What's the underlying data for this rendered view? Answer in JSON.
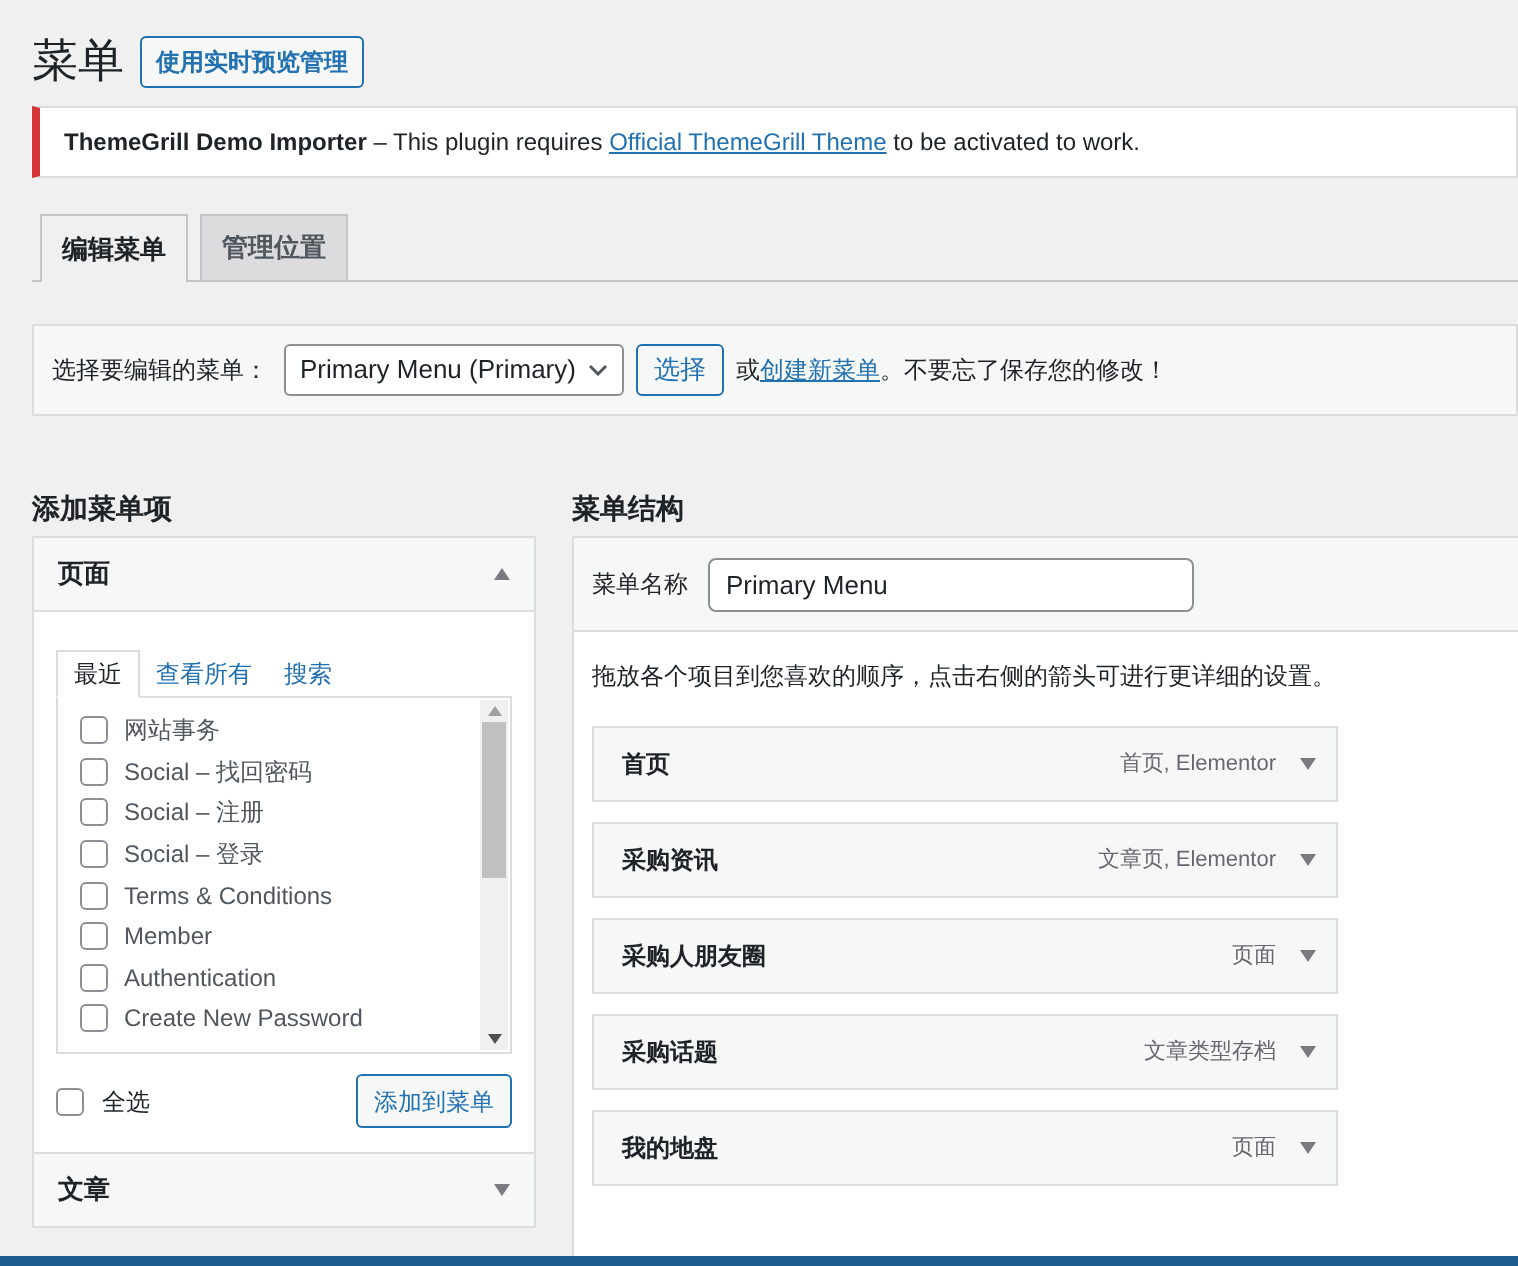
{
  "page_title": "菜单",
  "live_preview_button": "使用实时预览管理",
  "notice": {
    "plugin": "ThemeGrill Demo Importer",
    "text_before": " – This plugin requires ",
    "link": "Official ThemeGrill Theme",
    "text_after": " to be activated to work."
  },
  "tabs": [
    {
      "label": "编辑菜单",
      "selected": true
    },
    {
      "label": "管理位置",
      "selected": false
    }
  ],
  "menu_select": {
    "label": "选择要编辑的菜单：",
    "value": "Primary Menu (Primary)",
    "button": "选择",
    "or_text": "或",
    "create_link": "创建新菜单",
    "reminder": "。不要忘了保存您的修改！"
  },
  "add_items": {
    "heading": "添加菜单项",
    "pages_panel": {
      "title": "页面",
      "expanded": true,
      "tabs": [
        {
          "label": "最近",
          "selected": true
        },
        {
          "label": "查看所有",
          "selected": false
        },
        {
          "label": "搜索",
          "selected": false
        }
      ],
      "items": [
        {
          "label": "网站事务",
          "checked": false
        },
        {
          "label": "Social – 找回密码",
          "checked": false
        },
        {
          "label": "Social – 注册",
          "checked": false
        },
        {
          "label": "Social – 登录",
          "checked": false
        },
        {
          "label": "Terms & Conditions",
          "checked": false
        },
        {
          "label": "Member",
          "checked": false
        },
        {
          "label": "Authentication",
          "checked": false
        },
        {
          "label": "Create New Password",
          "checked": false
        }
      ],
      "select_all": {
        "label": "全选",
        "checked": false
      },
      "add_button": "添加到菜单"
    },
    "posts_panel": {
      "title": "文章",
      "expanded": false
    }
  },
  "structure": {
    "heading": "菜单结构",
    "name_label": "菜单名称",
    "name_value": "Primary Menu",
    "hint": "拖放各个项目到您喜欢的顺序，点击右侧的箭头可进行更详细的设置。",
    "items": [
      {
        "title": "首页",
        "type": "首页, Elementor"
      },
      {
        "title": "采购资讯",
        "type": "文章页, Elementor"
      },
      {
        "title": "采购人朋友圈",
        "type": "页面"
      },
      {
        "title": "采购话题",
        "type": "文章类型存档"
      },
      {
        "title": "我的地盘",
        "type": "页面"
      }
    ]
  }
}
